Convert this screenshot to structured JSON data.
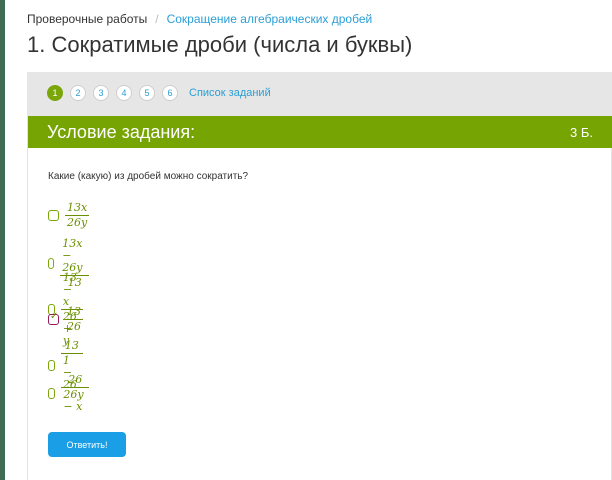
{
  "breadcrumb": {
    "root": "Проверочные работы",
    "separator": "/",
    "current": "Сокращение алгебраических дробей"
  },
  "page_title": "1. Сократимые дроби (числа и буквы)",
  "paginator": {
    "pages": [
      "1",
      "2",
      "3",
      "4",
      "5",
      "6"
    ],
    "active_page": "1",
    "task_list_label": "Список заданий"
  },
  "task": {
    "header_title": "Условие задания:",
    "points": "3 Б.",
    "question": "Какие (какую) из дробей можно сократить?",
    "options": [
      {
        "numerator": "13x",
        "denominator": "26y",
        "checked": false
      },
      {
        "numerator": "13x − 26y",
        "denominator": "13",
        "checked": false
      },
      {
        "numerator": "13 − x",
        "denominator": "26 + y",
        "checked": false
      },
      {
        "numerator": "13",
        "denominator": "26",
        "checked": true
      },
      {
        "numerator": "13",
        "denominator": "1 − 26",
        "checked": false
      },
      {
        "numerator": "26",
        "denominator": "26y − x",
        "checked": false
      }
    ],
    "submit_label": "Ответить!"
  },
  "colors": {
    "accent_green": "#76a402",
    "link_blue": "#2a9fd6",
    "button_blue": "#1a9ee6",
    "checked_border": "#9b1b5a"
  }
}
